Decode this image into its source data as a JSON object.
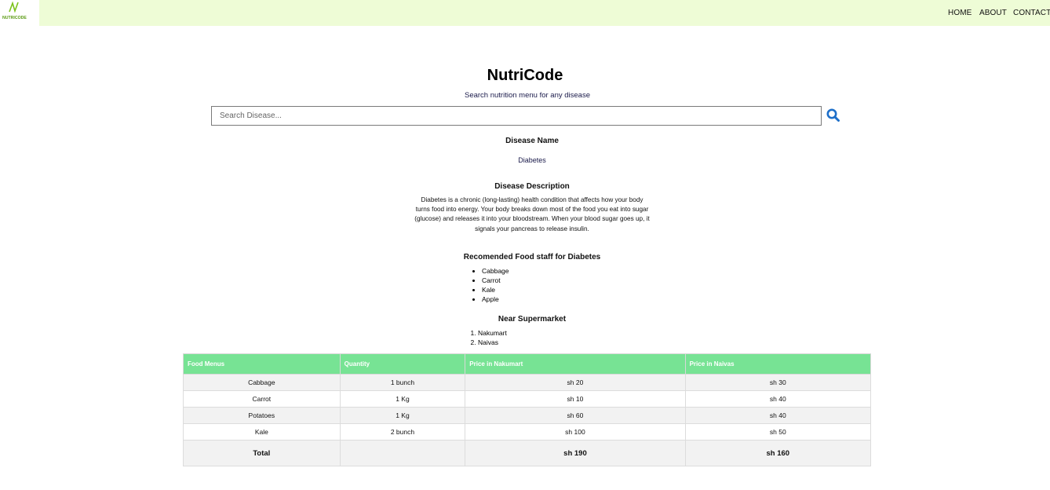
{
  "nav": {
    "logo_text": "NUTRICODE",
    "home": "HOME",
    "about": "ABOUT",
    "contacts": "CONTACTS"
  },
  "header": {
    "title": "NutriCode",
    "subtitle": "Search nutrition menu for any disease"
  },
  "search": {
    "placeholder": "Search Disease...",
    "icon": "search-icon"
  },
  "disease": {
    "name_heading": "Disease Name",
    "name": "Diabetes",
    "description_heading": "Disease Description",
    "description": "Diabetes is a chronic (long-lasting) health condition that affects how your body turns food into energy. Your body breaks down most of the food you eat into sugar (glucose) and releases it into your bloodstream. When your blood sugar goes up, it signals your pancreas to release insulin."
  },
  "food": {
    "heading": "Recomended Food staff for Diabetes",
    "items": [
      "Cabbage",
      "Carrot",
      "Kale",
      "Apple"
    ]
  },
  "supermarket": {
    "heading": "Near Supermarket",
    "items": [
      "Nakumart",
      "Naivas"
    ]
  },
  "table": {
    "headers": [
      "Food Menus",
      "Quantity",
      "Price in Nakumart",
      "Price in Naivas"
    ],
    "rows": [
      [
        "Cabbage",
        "1 bunch",
        "sh 20",
        "sh 30"
      ],
      [
        "Carrot",
        "1 Kg",
        "sh 10",
        "sh 40"
      ],
      [
        "Potatoes",
        "1 Kg",
        "sh 60",
        "sh 40"
      ],
      [
        "Kale",
        "2 bunch",
        "sh 100",
        "sh 50"
      ]
    ],
    "total": [
      "Total",
      "",
      "sh 190",
      "sh 160"
    ]
  },
  "colors": {
    "topbar": "#eefcd6",
    "table_header": "#77e394",
    "search_icon": "#1e6fc9",
    "logo_green": "#7cc21a"
  }
}
